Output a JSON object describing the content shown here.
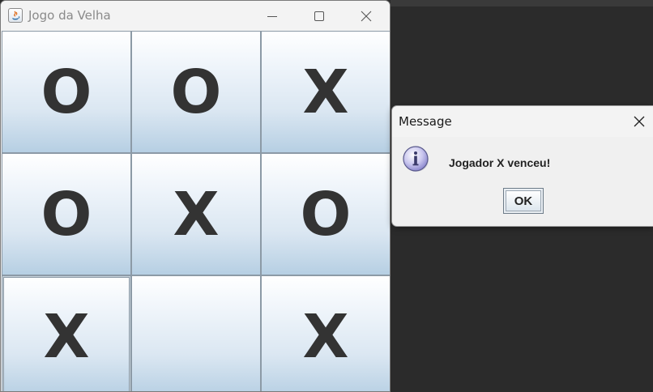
{
  "window": {
    "title": "Jogo da Velha",
    "controls": [
      "minimize-icon",
      "maximize-icon",
      "close-icon"
    ]
  },
  "board": {
    "cells": [
      [
        "O",
        "O",
        "X"
      ],
      [
        "O",
        "X",
        "O"
      ],
      [
        "X",
        "",
        "X"
      ]
    ]
  },
  "dialog": {
    "title": "Message",
    "icon": "info-icon",
    "message": "Jogador X venceu!",
    "ok_label": "OK"
  },
  "colors": {
    "desktop": "#2b2b2b",
    "cell_top": "#ffffff",
    "cell_bottom": "#b6cfe3",
    "mark": "#333333"
  }
}
